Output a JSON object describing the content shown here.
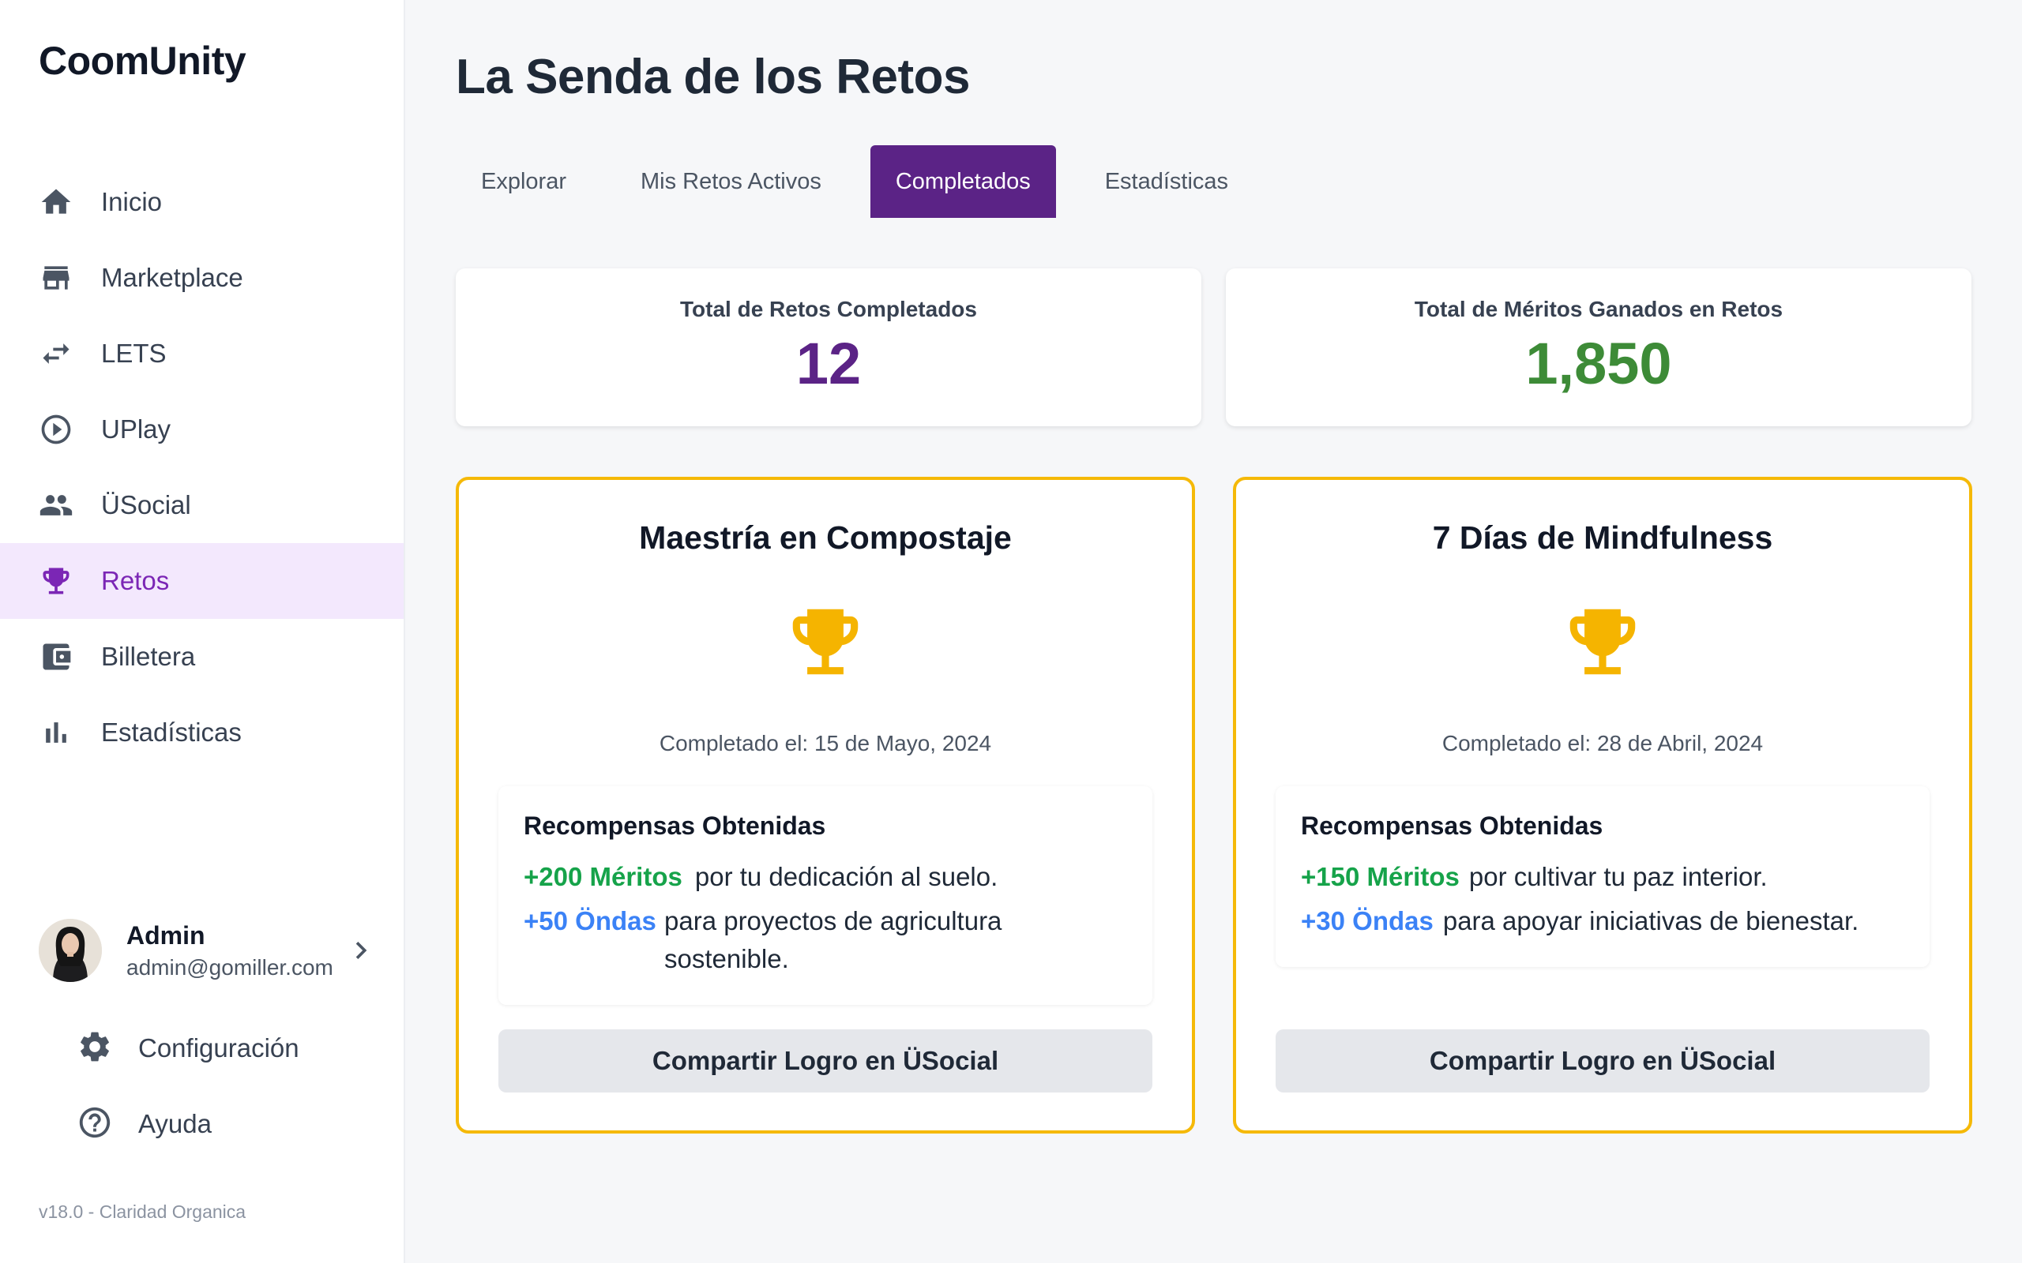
{
  "app": {
    "logo": "CoomUnity",
    "version": "v18.0 - Claridad Organica"
  },
  "sidebar": {
    "items": [
      {
        "label": "Inicio",
        "icon": "home-icon",
        "active": false
      },
      {
        "label": "Marketplace",
        "icon": "store-icon",
        "active": false
      },
      {
        "label": "LETS",
        "icon": "swap-arrows-icon",
        "active": false
      },
      {
        "label": "UPlay",
        "icon": "play-circle-icon",
        "active": false
      },
      {
        "label": "ÜSocial",
        "icon": "people-icon",
        "active": false
      },
      {
        "label": "Retos",
        "icon": "trophy-icon",
        "active": true
      },
      {
        "label": "Billetera",
        "icon": "wallet-icon",
        "active": false
      },
      {
        "label": "Estadísticas",
        "icon": "bar-chart-icon",
        "active": false
      }
    ],
    "profile": {
      "name": "Admin",
      "email": "admin@gomiller.com"
    },
    "settings_label": "Configuración",
    "help_label": "Ayuda"
  },
  "main": {
    "title": "La Senda de los Retos",
    "tabs": [
      {
        "label": "Explorar",
        "active": false
      },
      {
        "label": "Mis Retos Activos",
        "active": false
      },
      {
        "label": "Completados",
        "active": true
      },
      {
        "label": "Estadísticas",
        "active": false
      }
    ],
    "stats": [
      {
        "label": "Total de Retos Completados",
        "value": "12",
        "color": "#5b2386"
      },
      {
        "label": "Total de Méritos Ganados en Retos",
        "value": "1,850",
        "color": "#3d8b37"
      }
    ],
    "achievements": [
      {
        "title": "Maestría en Compostaje",
        "date": "Completado el: 15 de Mayo, 2024",
        "rewards_title": "Recompensas Obtenidas",
        "rewards": [
          {
            "amount": "+200 Méritos",
            "desc": "por tu dedicación al suelo."
          },
          {
            "amount": "+50 Öndas",
            "desc": "para proyectos de agricultura sostenible."
          }
        ],
        "share_label": "Compartir Logro en ÜSocial"
      },
      {
        "title": "7 Días de Mindfulness",
        "date": "Completado el: 28 de Abril, 2024",
        "rewards_title": "Recompensas Obtenidas",
        "rewards": [
          {
            "amount": "+150 Méritos",
            "desc": "por cultivar tu paz interior."
          },
          {
            "amount": "+30 Öndas",
            "desc": "para apoyar iniciativas de bienestar."
          }
        ],
        "share_label": "Compartir Logro en ÜSocial"
      }
    ]
  },
  "colors": {
    "accent": "#5b2386",
    "active_nav": "#7b26b5",
    "card_border": "#f5b908",
    "trophy": "#f5b400",
    "meritos": "#16a34a",
    "ondas": "#3b82f6"
  }
}
